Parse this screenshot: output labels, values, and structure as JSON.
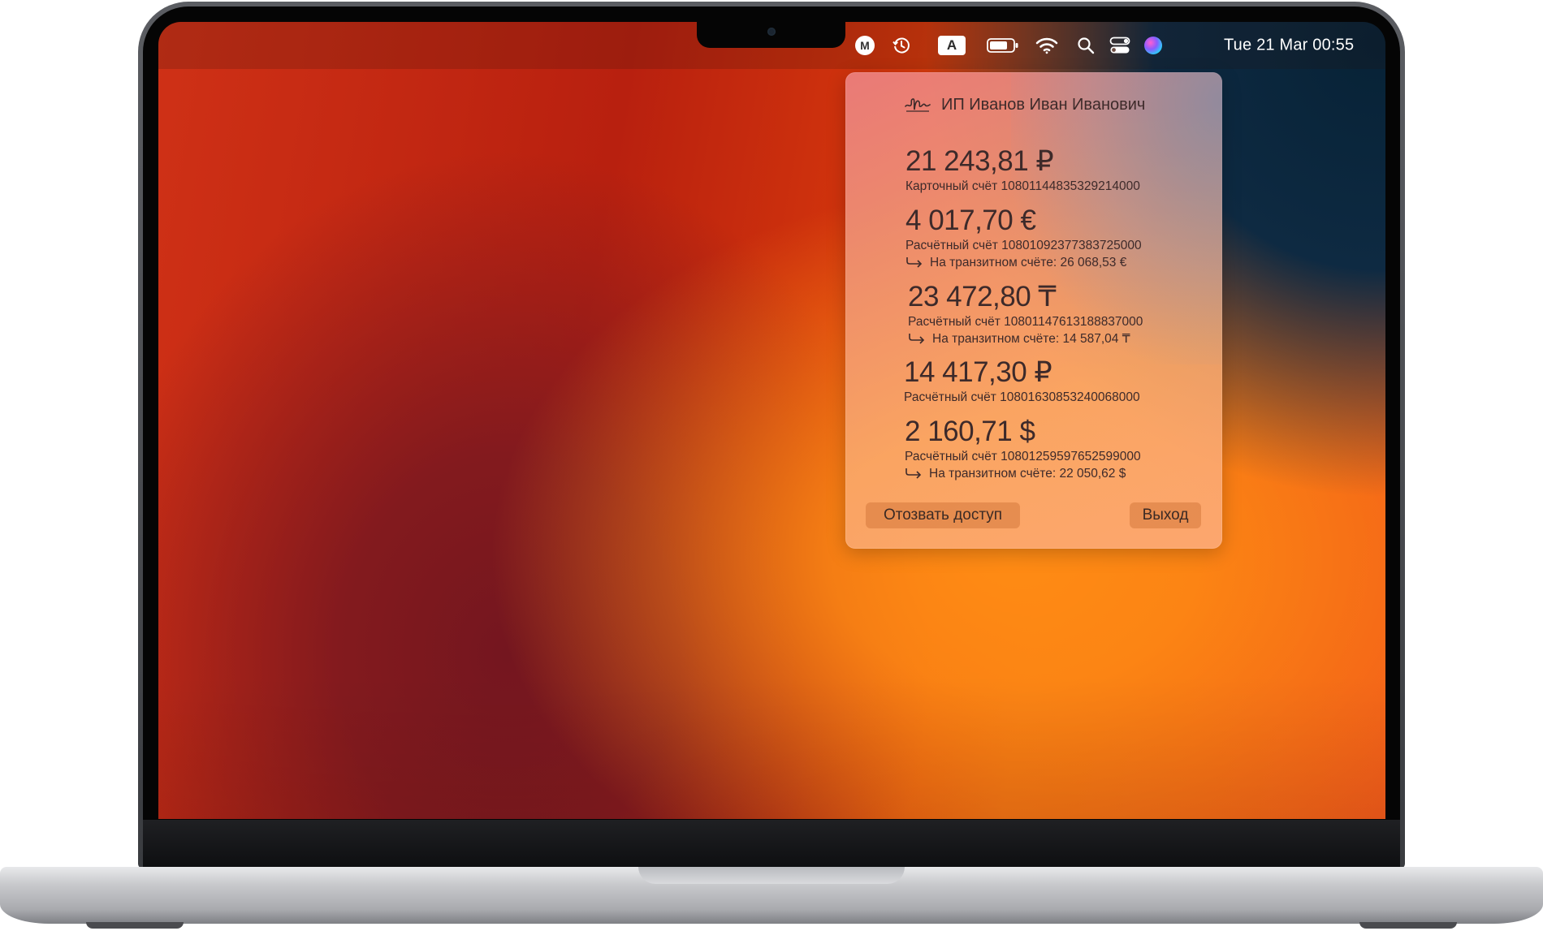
{
  "menubar": {
    "items": [
      {
        "name": "M",
        "icon": "m-badge-icon"
      },
      {
        "icon": "time-machine-icon"
      },
      {
        "name": "A",
        "icon": "input-source-icon"
      },
      {
        "icon": "battery-icon"
      },
      {
        "icon": "wifi-icon"
      },
      {
        "icon": "search-icon"
      },
      {
        "icon": "control-center-icon"
      },
      {
        "icon": "siri-icon"
      }
    ],
    "clock": "Tue 21 Mar  00:55"
  },
  "popover": {
    "title": "ИП Иванов Иван Иванович",
    "title_icon": "signature-icon",
    "accounts": [
      {
        "amount": "21 243,81 ₽",
        "label": "Карточный счёт 10801144835329214000"
      },
      {
        "amount": "4 017,70 €",
        "label": "Расчётный счёт 10801092377383725000",
        "transit": "На транзитном счёте: 26 068,53 €"
      },
      {
        "amount": "23 472,80 ₸",
        "label": "Расчётный счёт 10801147613188837000",
        "transit": "На транзитном счёте: 14 587,04 ₸"
      },
      {
        "amount": "14 417,30 ₽",
        "label": "Расчётный счёт 10801630853240068000"
      },
      {
        "amount": "2 160,71 $",
        "label": "Расчётный счёт 10801259597652599000",
        "transit": "На транзитном счёте: 22 050,62 $"
      }
    ],
    "revoke_label": "Отозвать доступ",
    "exit_label": "Выход"
  },
  "colors": {
    "wallpaper_red": "#c5220f",
    "wallpaper_orange": "#ff8b14",
    "popover_text": "#3d2a2a",
    "button_bg": "#d6783c"
  }
}
